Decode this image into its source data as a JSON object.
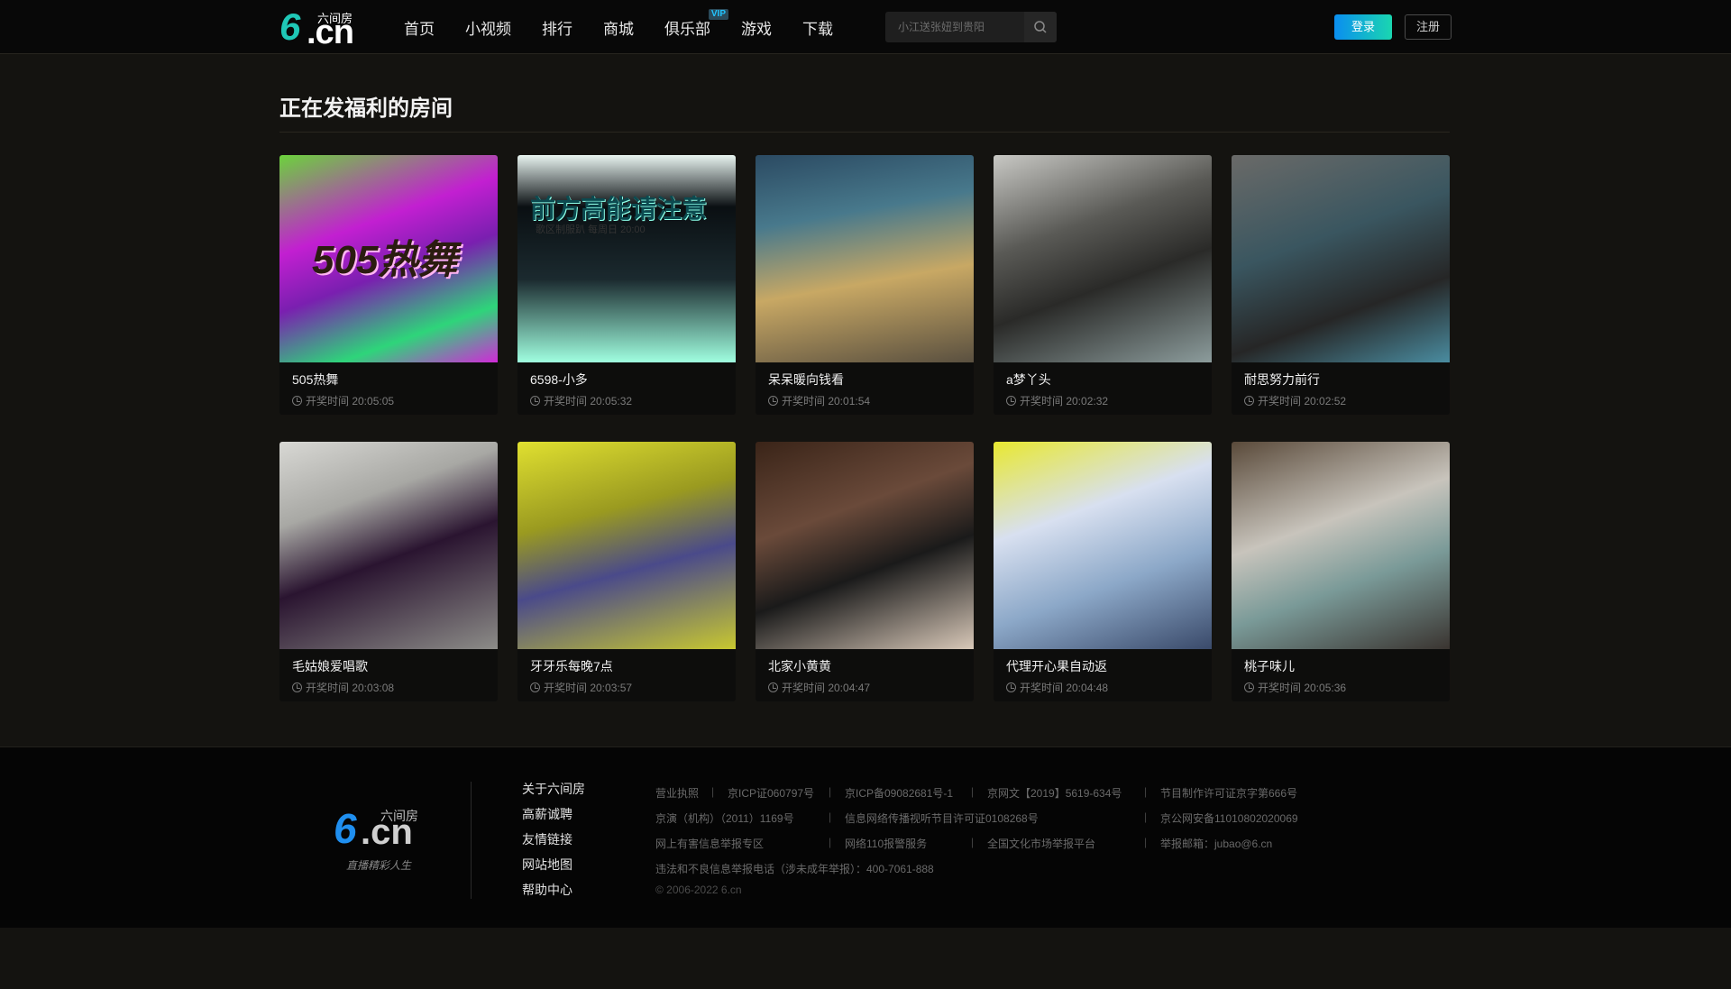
{
  "header": {
    "logo": {
      "mark": "6",
      "domain": ".cn",
      "brand": "六间房"
    },
    "nav": [
      {
        "label": "首页"
      },
      {
        "label": "小视频"
      },
      {
        "label": "排行"
      },
      {
        "label": "商城"
      },
      {
        "label": "俱乐部",
        "badge": "VIP"
      },
      {
        "label": "游戏"
      },
      {
        "label": "下载"
      }
    ],
    "search": {
      "placeholder": "小江送张妞到贵阳"
    },
    "login_label": "登录",
    "register_label": "注册"
  },
  "main": {
    "title": "正在发福利的房间",
    "time_prefix": "开奖时间",
    "rooms": [
      {
        "name": "505热舞",
        "time": "开奖时间 20:05:05",
        "thumb_text": "505热舞"
      },
      {
        "name": "6598-小多",
        "time": "开奖时间 20:05:32",
        "thumb_text": "前方高能请注意",
        "thumb_sub": "歌区制服趴 每周日 20:00"
      },
      {
        "name": "呆呆暖向钱看",
        "time": "开奖时间 20:01:54"
      },
      {
        "name": "a梦丫头",
        "time": "开奖时间 20:02:32"
      },
      {
        "name": "耐思努力前行",
        "time": "开奖时间 20:02:52"
      },
      {
        "name": "毛姑娘爱唱歌",
        "time": "开奖时间 20:03:08"
      },
      {
        "name": "牙牙乐每晚7点",
        "time": "开奖时间 20:03:57"
      },
      {
        "name": "北家小黄黄",
        "time": "开奖时间 20:04:47"
      },
      {
        "name": "代理开心果自动返",
        "time": "开奖时间 20:04:48"
      },
      {
        "name": "桃子味儿",
        "time": "开奖时间 20:05:36"
      }
    ]
  },
  "footer": {
    "logo": {
      "mark": "6",
      "domain": ".cn",
      "brand": "六间房",
      "slogan": "直播精彩人生"
    },
    "links": [
      "关于六间房",
      "高薪诚聘",
      "友情链接",
      "网站地图",
      "帮助中心"
    ],
    "info": {
      "row1": [
        "营业执照",
        "京ICP证060797号",
        "京ICP备09082681号-1",
        "京网文【2019】5619-634号",
        "节目制作许可证京字第666号"
      ],
      "row2": [
        "京演（机构）（2011）1169号",
        "信息网络传播视听节目许可证0108268号",
        "京公网安备11010802020069"
      ],
      "row3": [
        "网上有害信息举报专区",
        "网络110报警服务",
        "全国文化市场举报平台",
        "举报邮箱：jubao@6.cn"
      ],
      "row4": "违法和不良信息举报电话（涉未成年举报）：400-7061-888",
      "copyright": "© 2006-2022 6.cn"
    }
  }
}
